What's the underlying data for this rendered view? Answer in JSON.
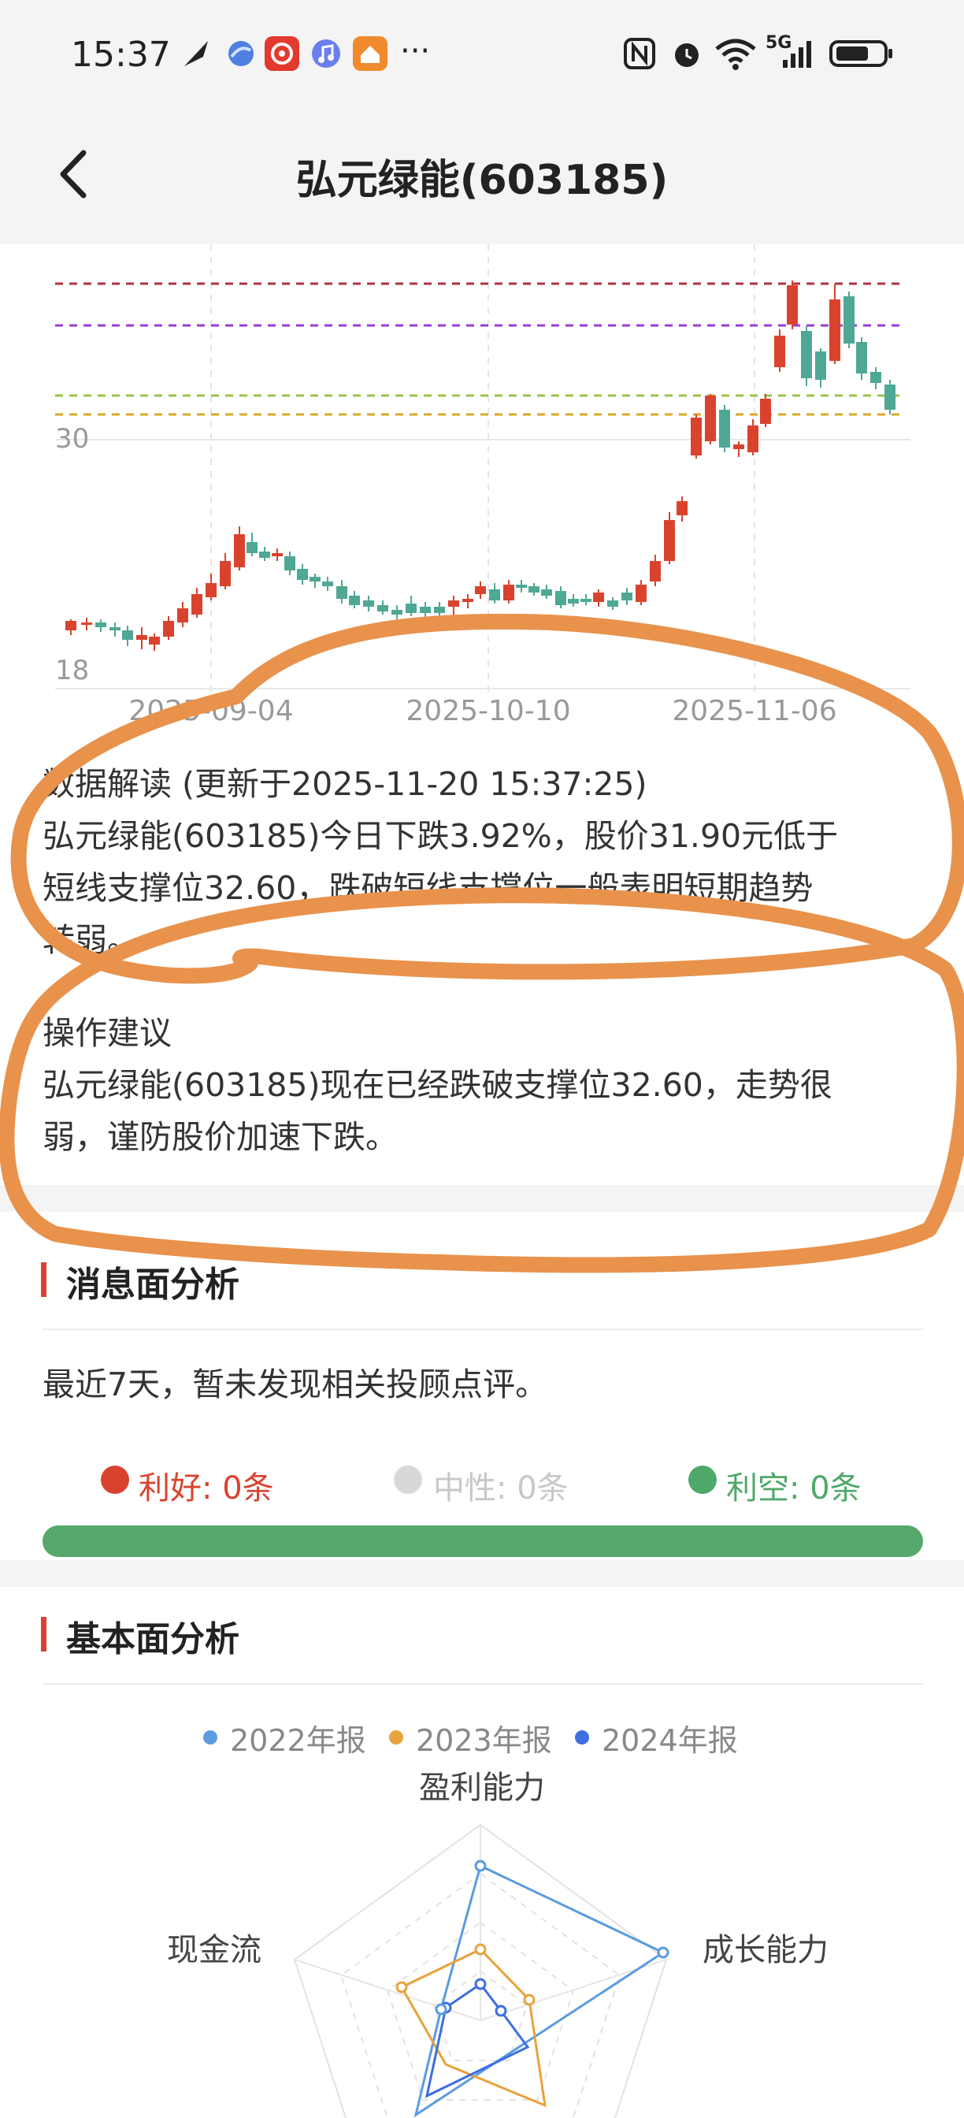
{
  "status_bar": {
    "time": "15:37",
    "more": "···",
    "network": "5G"
  },
  "header": {
    "title": "弘元绿能(603185)"
  },
  "chart": {
    "y_labels": [
      "30",
      "18"
    ],
    "x_labels": [
      "2025-09-04",
      "2025-10-10",
      "2025-11-06"
    ],
    "up_color": "#d9432e",
    "down_color": "#4ea895"
  },
  "interpretation": {
    "title": "数据解读 (更新于2025-11-20 15:37:25)",
    "line1": "弘元绿能(603185)今日下跌3.92%，股价31.90元低于",
    "line2": "短线支撑位32.60，跌破短线支撑位一般表明短期趋势",
    "line3": "转弱。"
  },
  "advice": {
    "title": "操作建议",
    "line1": "弘元绿能(603185)现在已经跌破支撑位32.60，走势很",
    "line2": "弱，谨防股价加速下跌。"
  },
  "news": {
    "title": "消息面分析",
    "text": "最近7天，暂未发现相关投顾点评。",
    "positive": "利好: 0条",
    "neutral": "中性: 0条",
    "negative": "利空: 0条",
    "positive_color": "#d9432e",
    "neutral_color": "#cccccc",
    "negative_color": "#4ea86a"
  },
  "fundamentals": {
    "title": "基本面分析",
    "legend": [
      "2022年报",
      "2023年报",
      "2024年报"
    ],
    "legend_colors": [
      "#5b9be0",
      "#e8a33c",
      "#3e6ee0"
    ],
    "axes": [
      "盈利能力",
      "成长能力",
      "现金流"
    ]
  }
}
